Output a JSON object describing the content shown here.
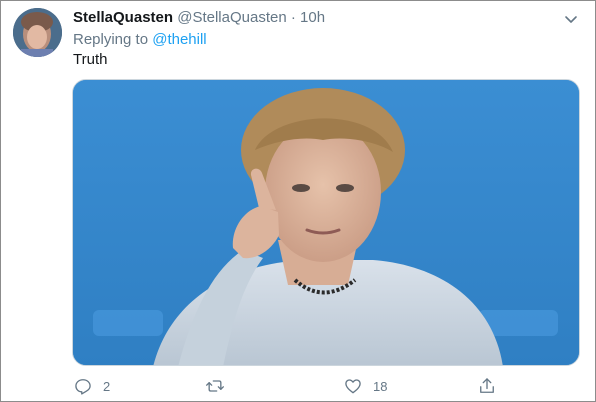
{
  "tweet": {
    "display_name": "StellaQuasten",
    "handle": "@StellaQuasten",
    "separator": "·",
    "time": "10h",
    "replying_to_label": "Replying to",
    "replying_to_mention": "@thehill",
    "text": "Truth"
  },
  "actions": {
    "reply_count": "2",
    "retweet_count": "",
    "like_count": "18",
    "share_count": ""
  },
  "colors": {
    "accent": "#1da1f2",
    "muted": "#657786",
    "text": "#14171a"
  },
  "icons": {
    "menu": "chevron-down-icon",
    "reply": "reply-icon",
    "retweet": "retweet-icon",
    "like": "heart-icon",
    "share": "share-icon"
  }
}
